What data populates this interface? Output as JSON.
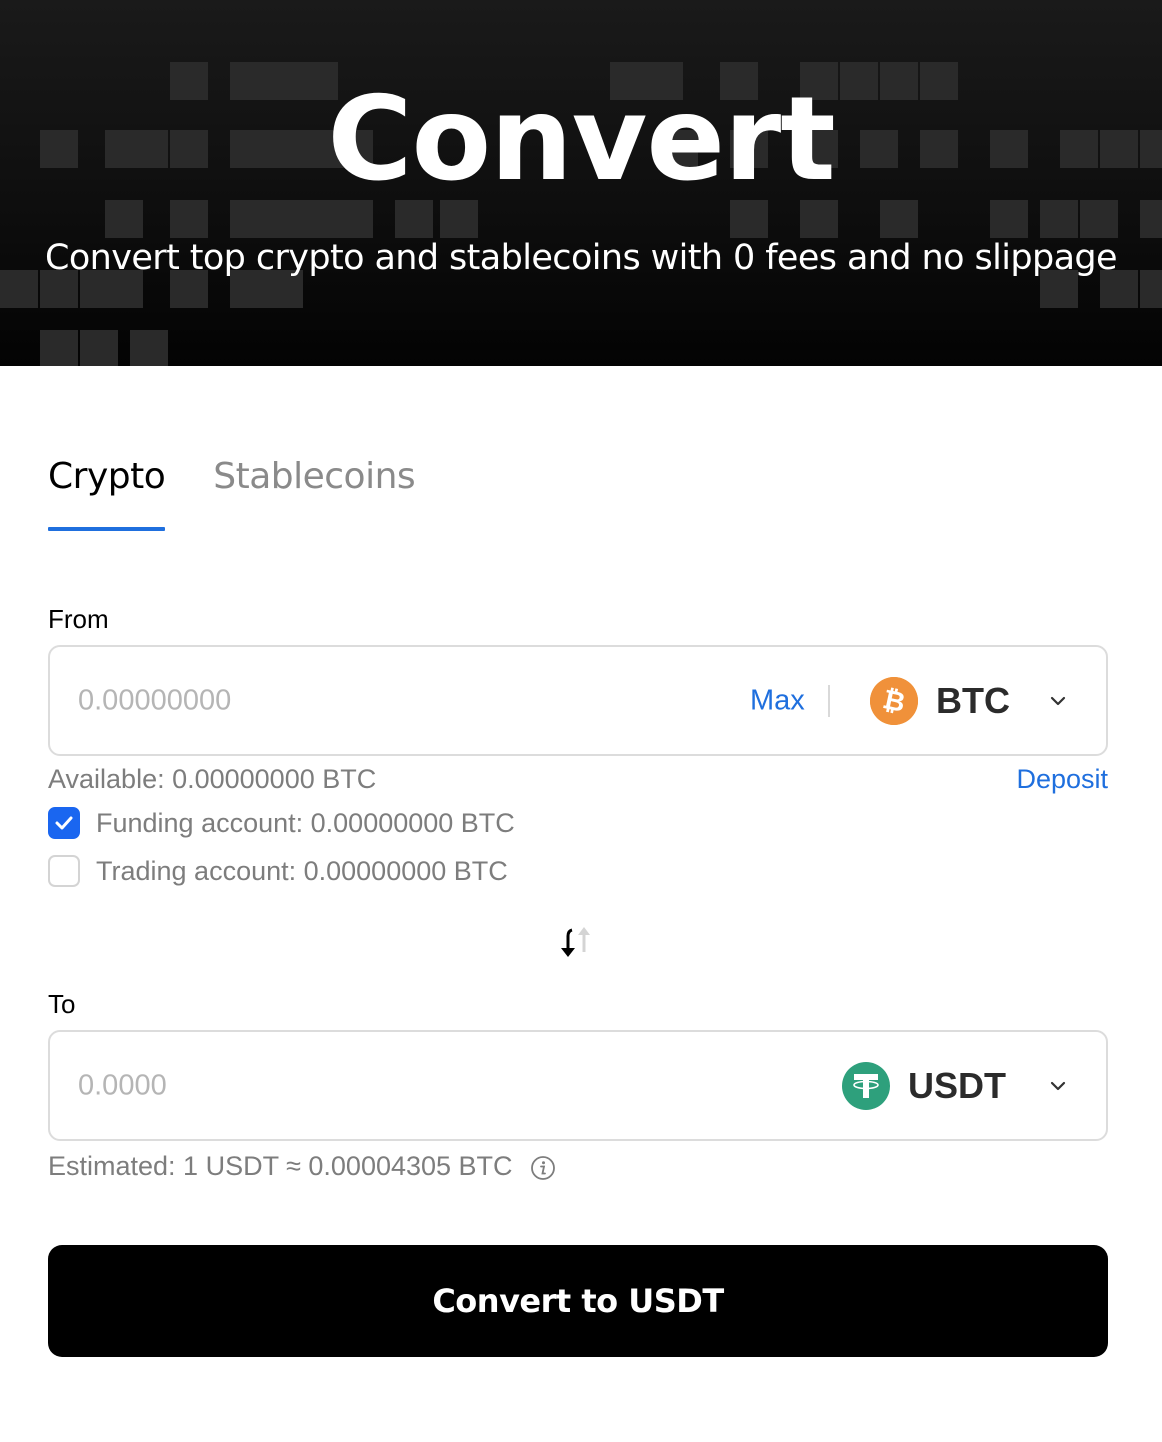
{
  "hero": {
    "title": "Convert",
    "subtitle": "Convert top crypto and stablecoins with 0 fees and no slippage"
  },
  "tabs": [
    {
      "label": "Crypto",
      "active": true
    },
    {
      "label": "Stablecoins",
      "active": false
    }
  ],
  "from": {
    "label": "From",
    "amount_placeholder": "0.00000000",
    "max_label": "Max",
    "coin": "BTC",
    "coin_icon": "bitcoin-icon",
    "coin_color": "#f7931a",
    "available": "Available: 0.00000000 BTC",
    "deposit_label": "Deposit",
    "accounts": [
      {
        "label": "Funding account: 0.00000000 BTC",
        "checked": true
      },
      {
        "label": "Trading account: 0.00000000 BTC",
        "checked": false
      }
    ]
  },
  "swap_icon": "swap-arrows-icon",
  "to": {
    "label": "To",
    "amount_placeholder": "0.0000",
    "coin": "USDT",
    "coin_icon": "tether-icon",
    "coin_color": "#26a17b",
    "estimate": "Estimated: 1 USDT ≈ 0.00004305 BTC"
  },
  "cta": {
    "label": "Convert to USDT"
  },
  "colors": {
    "accent": "#1f6fde",
    "checkbox": "#1a66f0",
    "button": "#000000"
  }
}
